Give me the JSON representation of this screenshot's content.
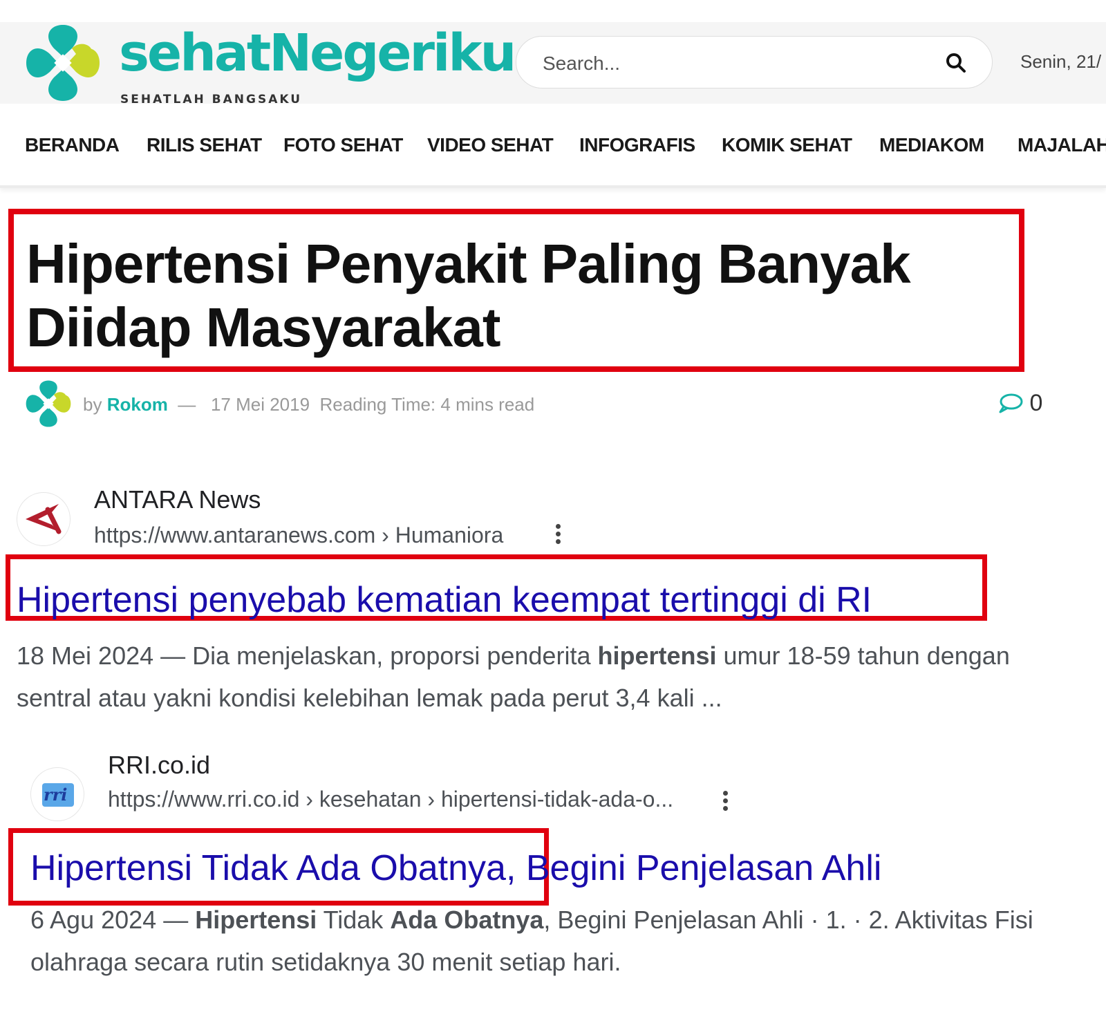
{
  "header": {
    "logo_text": "sehatNegeriku",
    "tagline": "SEHATLAH BANGSAKU",
    "search_placeholder": "Search...",
    "date": "Senin, 21/"
  },
  "nav": {
    "items": [
      "BERANDA",
      "RILIS SEHAT",
      "FOTO SEHAT",
      "VIDEO SEHAT",
      "INFOGRAFIS",
      "KOMIK SEHAT",
      "MEDIAKOM",
      "MAJALAH"
    ]
  },
  "article": {
    "title": "Hipertensi Penyakit Paling Banyak Diidap Masyarakat",
    "by": "by",
    "author": "Rokom",
    "dash": "—",
    "date": "17 Mei 2019",
    "reading_time": "Reading Time: 4 mins read",
    "comment_count": "0"
  },
  "results": [
    {
      "site_name": "ANTARA News",
      "url": "https://www.antaranews.com",
      "breadcrumb": "› Humaniora",
      "title": "Hipertensi penyebab kematian keempat tertinggi di RI",
      "snippet_date": "18 Mei 2024",
      "snippet_1a": " — Dia menjelaskan, proporsi penderita ",
      "snippet_1b": "hipertensi",
      "snippet_1c": " umur 18-59 tahun dengan",
      "snippet_2": "sentral atau yakni kondisi kelebihan lemak pada perut 3,4 kali ..."
    },
    {
      "site_name": "RRI.co.id",
      "url": "https://www.rri.co.id",
      "breadcrumb": "› kesehatan › hipertensi-tidak-ada-o...",
      "favicon_text": "rri",
      "title": "Hipertensi Tidak Ada Obatnya, Begini Penjelasan Ahli",
      "snippet_date": "6 Agu 2024",
      "snippet_1a": " — ",
      "snippet_1b": "Hipertensi",
      "snippet_1c": " Tidak ",
      "snippet_1d": "Ada Obatnya",
      "snippet_1e": ", Begini Penjelasan Ahli · 1. · 2. Aktivitas Fisi",
      "snippet_2": "olahraga secara rutin setidaknya 30 menit setiap hari."
    }
  ],
  "colors": {
    "brand": "#16b3a8",
    "brand_yellow": "#c8d72a",
    "highlight": "#e0000f",
    "link": "#1a0dab"
  },
  "icons": [
    "logo-clover-icon",
    "search-icon",
    "comment-icon",
    "antara-favicon-icon",
    "rri-favicon-icon",
    "more-vert-icon"
  ]
}
